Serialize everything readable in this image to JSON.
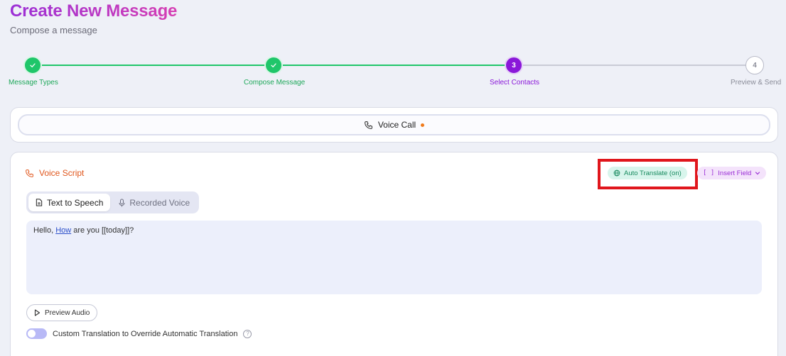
{
  "header": {
    "title": "Create New Message",
    "subtitle": "Compose a message"
  },
  "stepper": {
    "steps": [
      {
        "number": "1",
        "label": "Message Types",
        "state": "done"
      },
      {
        "number": "2",
        "label": "Compose Message",
        "state": "done"
      },
      {
        "number": "3",
        "label": "Select Contacts",
        "state": "active"
      },
      {
        "number": "4",
        "label": "Preview & Send",
        "state": "pending"
      }
    ],
    "colors": {
      "done": "#1fc66a",
      "active": "#8a18d9",
      "pending": "#b9bbc8"
    }
  },
  "channel": {
    "label": "Voice Call",
    "icon": "phone-icon",
    "indicator_color": "#f07a1a"
  },
  "script": {
    "title": "Voice Script",
    "title_icon": "phone-icon",
    "auto_translate_label": "Auto Translate (on)",
    "auto_translate_icon": "globe-icon",
    "insert_field_label": "Insert Field",
    "insert_field_icon": "brackets-icon",
    "tabs": [
      {
        "label": "Text to Speech",
        "icon": "document-icon",
        "selected": true
      },
      {
        "label": "Recorded Voice",
        "icon": "microphone-icon",
        "selected": false
      }
    ],
    "content_prefix": "Hello, ",
    "content_underlined": "How",
    "content_suffix": " are you [[today]]?",
    "preview_button_label": "Preview Audio",
    "preview_button_icon": "play-icon",
    "custom_translation_label": "Custom Translation to Override Automatic Translation",
    "custom_translation_enabled": false
  },
  "annotation": {
    "highlight_color": "#e0161c",
    "highlight_target": "Auto Translate (on)"
  }
}
